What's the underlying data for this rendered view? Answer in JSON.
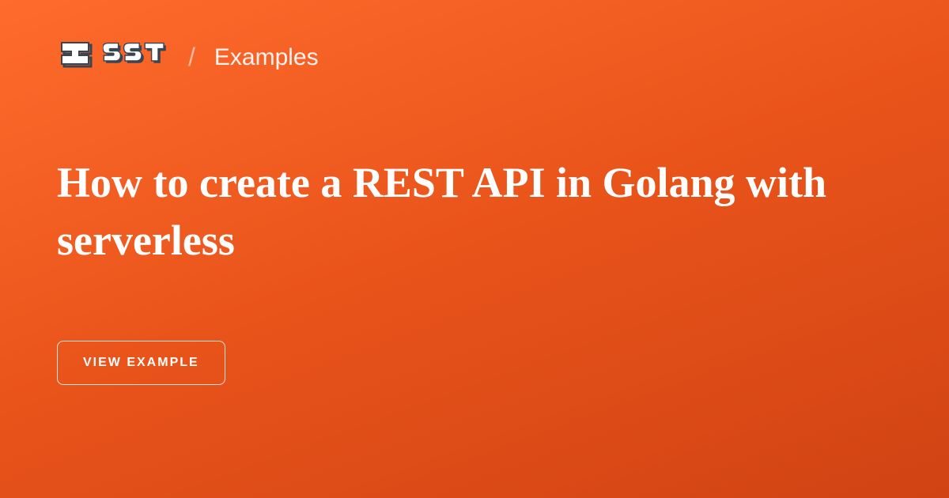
{
  "header": {
    "breadcrumb_separator": "/",
    "breadcrumb_label": "Examples"
  },
  "main": {
    "title": "How to create a REST API in Golang with serverless"
  },
  "cta": {
    "button_label": "VIEW EXAMPLE"
  }
}
